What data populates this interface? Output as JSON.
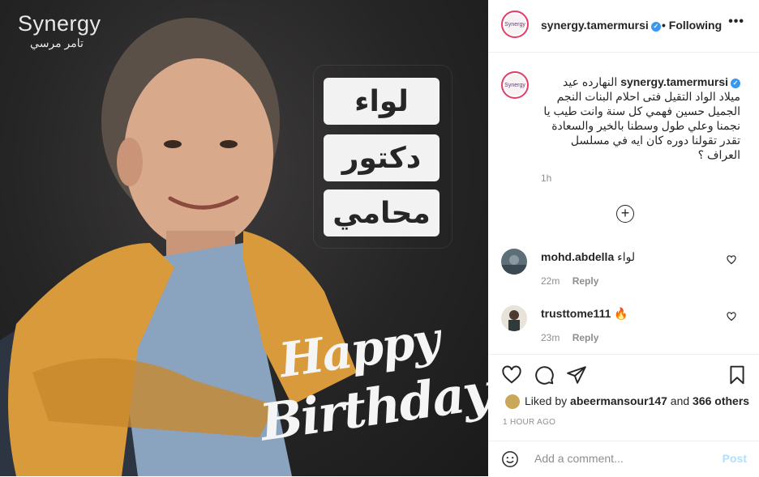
{
  "photo": {
    "brand_name": "Synergy",
    "brand_sub": "تامر مرسي",
    "labels": [
      "لواء",
      "دكتور",
      "محامي"
    ],
    "greeting_line1": "Happy",
    "greeting_line2": "Birthday"
  },
  "header": {
    "username": "synergy.tamermursi",
    "follow_status": "Following",
    "more_icon": "ellipsis-icon",
    "avatar_text": "Synergy"
  },
  "caption": {
    "username": "synergy.tamermursi",
    "text": "النهارده عيد ميلاد الواد التقيل فتى احلام البنات النجم الجميل حسين فهمي كل سنة وانت طيب يا نجمنا وعلي طول وسطنا بالخير والسعادة تقدر تقولنا دوره كان ايه في مسلسل العراف ؟",
    "time": "1h"
  },
  "load_more_icon": "plus-circle-icon",
  "comments": [
    {
      "username": "mohd.abdella",
      "text": "لواء",
      "time": "22m",
      "reply": "Reply"
    },
    {
      "username": "trusttome111",
      "text": "🔥",
      "time": "23m",
      "reply": "Reply"
    }
  ],
  "likes": {
    "prefix": "Liked by",
    "user": "abeermansour147",
    "joiner": "and",
    "others": "366 others"
  },
  "posted_ago": "1 HOUR AGO",
  "add_comment": {
    "placeholder": "Add a comment...",
    "post_label": "Post"
  },
  "colors": {
    "verified": "#3897f0",
    "post_disabled": "#b2dffc",
    "muted": "#8e8e8e"
  }
}
